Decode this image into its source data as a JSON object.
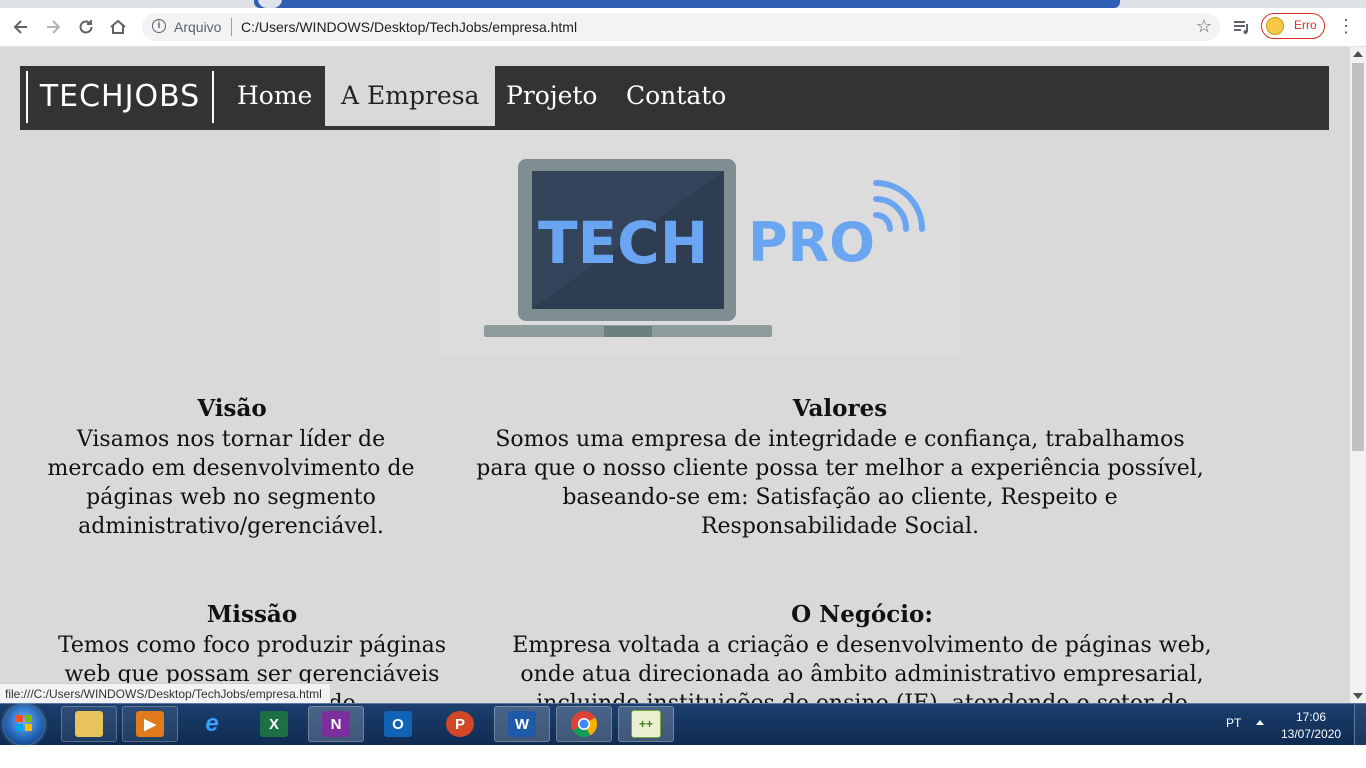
{
  "browser": {
    "address_label": "Arquivo",
    "url": "C:/Users/WINDOWS/Desktop/TechJobs/empresa.html",
    "profile_status": "Erro",
    "status_url": "file:///C:/Users/WINDOWS/Desktop/TechJobs/empresa.html"
  },
  "site": {
    "logo": "TECHJOBS",
    "nav": [
      {
        "label": "Home",
        "active": false
      },
      {
        "label": "A Empresa",
        "active": true
      },
      {
        "label": "Projeto",
        "active": false
      },
      {
        "label": "Contato",
        "active": false
      }
    ],
    "hero": {
      "word1": "TECH",
      "word2": "PRO"
    },
    "sections": {
      "visao": {
        "title": "Visão",
        "lines": [
          "Visamos nos tornar líder de",
          "mercado em desenvolvimento de",
          "páginas web no segmento",
          "administrativo/gerenciável."
        ]
      },
      "valores": {
        "title": "Valores",
        "lines": [
          "Somos uma empresa de integridade e confiança, trabalhamos",
          "para que o nosso cliente possa ter melhor a experiência possível,",
          "baseando-se em: Satisfação ao cliente, Respeito e",
          "Responsabilidade Social."
        ]
      },
      "missao": {
        "title": "Missão",
        "lines": [
          "Temos como foco produzir páginas",
          "web que possam ser gerenciáveis",
          "por instituições de"
        ]
      },
      "negocio": {
        "title": "O Negócio:",
        "lines": [
          "Empresa voltada a criação e desenvolvimento de páginas web,",
          "onde atua direcionada ao âmbito administrativo empresarial,",
          "incluindo instituições de ensino (IE), atendendo o setor de"
        ]
      }
    }
  },
  "taskbar": {
    "lang": "PT",
    "time": "17:06",
    "date": "13/07/2020",
    "apps": [
      "file-explorer",
      "media-player",
      "internet-explorer",
      "excel",
      "onenote",
      "outlook",
      "powerpoint",
      "word",
      "chrome",
      "notepad-plus-plus"
    ]
  },
  "colors": {
    "nav_bg": "#333333",
    "page_bg": "#d9d9d9",
    "hero_blue": "#6aa5f2",
    "laptop_screen": "#34445a",
    "laptop_body": "#7f8f91",
    "taskbar": "#1c3f6e"
  }
}
